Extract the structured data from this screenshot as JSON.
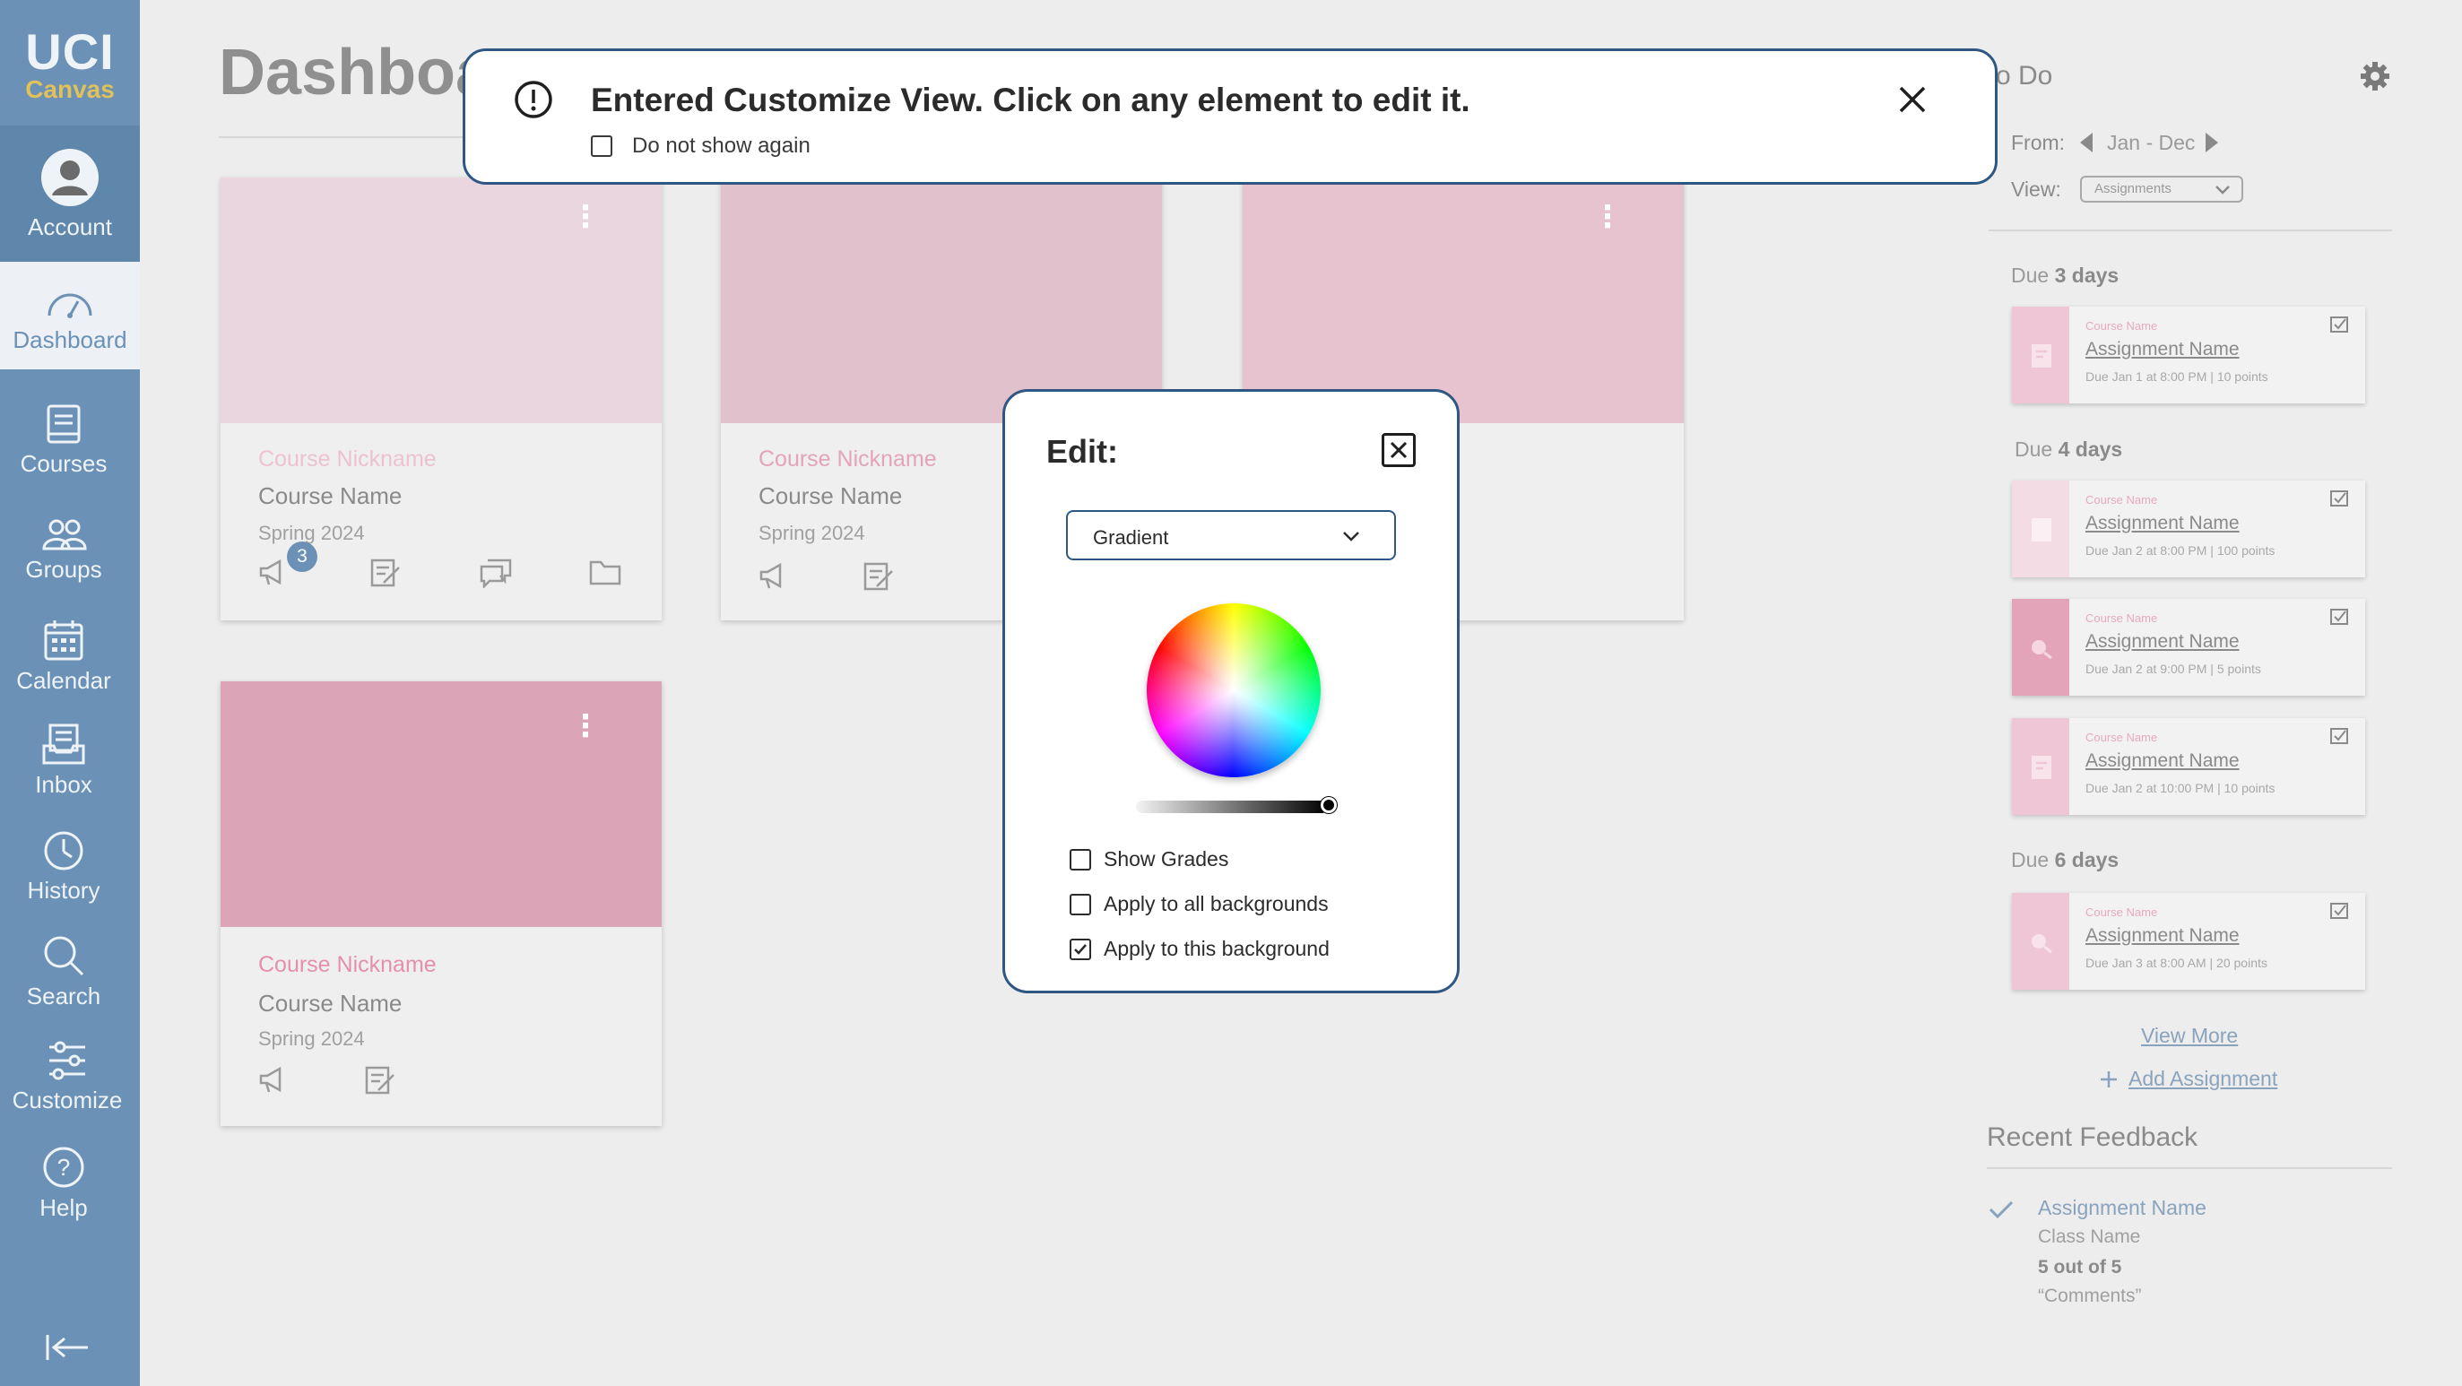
{
  "sidebar": {
    "logo_top": "UCI",
    "logo_bottom": "Canvas",
    "account": "Account",
    "dashboard": "Dashboard",
    "courses": "Courses",
    "groups": "Groups",
    "calendar": "Calendar",
    "inbox": "Inbox",
    "history": "History",
    "search": "Search",
    "customize": "Customize",
    "help": "Help"
  },
  "main": {
    "title": "Dashboa",
    "cards": [
      {
        "nickname": "Course Nickname",
        "name": "Course Name",
        "term": "Spring 2024",
        "badge": "3",
        "banner_color": "#ead6de",
        "nick_color": "#ecc2d1"
      },
      {
        "nickname": "Course Nickname",
        "name": "Course Name",
        "term": "Spring 2024",
        "banner_color": "#e0c1cc",
        "nick_color": "#e3a4ba"
      },
      {
        "nickname": "",
        "name": "",
        "term": "",
        "banner_color": "#e7c2cf"
      },
      {
        "nickname": "Course Nickname",
        "name": "Course Name",
        "term": "Spring 2024",
        "banner_color": "#dca5b7",
        "nick_color": "#e58fae"
      }
    ]
  },
  "todo": {
    "title": "o Do",
    "from_label": "From:",
    "range": "Jan - Dec",
    "view_label": "View:",
    "view_value": "Assignments",
    "groups": [
      {
        "label_pre": "Due",
        "label_bold": "3 days",
        "items": [
          {
            "course": "Course Name",
            "name": "Assignment Name",
            "due": "Due Jan 1 at 8:00 PM  |  10 points"
          }
        ]
      },
      {
        "label_pre": "Due",
        "label_bold": "4 days",
        "items": [
          {
            "course": "Course Name",
            "name": "Assignment Name",
            "due": "Due Jan 2 at 8:00 PM  |  100 points"
          },
          {
            "course": "Course Name",
            "name": "Assignment Name",
            "due": "Due Jan 2 at 9:00 PM  |  5 points"
          },
          {
            "course": "Course Name",
            "name": "Assignment Name",
            "due": "Due Jan 2 at 10:00 PM  |  10 points"
          }
        ]
      },
      {
        "label_pre": "Due",
        "label_bold": "6 days",
        "items": [
          {
            "course": "Course Name",
            "name": "Assignment Name",
            "due": "Due Jan 3 at 8:00 AM  |  20 points"
          }
        ]
      }
    ],
    "view_more": "View More",
    "add_assignment": "Add Assignment"
  },
  "feedback": {
    "title": "Recent Feedback",
    "assignment": "Assignment Name",
    "class": "Class Name",
    "score": "5 out of 5",
    "comments": "“Comments”"
  },
  "notice": {
    "message": "Entered Customize View. Click on any element to edit it.",
    "checkbox_label": "Do not show again"
  },
  "editor": {
    "title": "Edit:",
    "mode": "Gradient",
    "show_grades": "Show Grades",
    "apply_all": "Apply to all backgrounds",
    "apply_this": "Apply to this background",
    "apply_this_checked": true
  },
  "colors": {
    "sidebar": "#6b92b6",
    "accent_border": "#2f5784",
    "pink": "#e58fae"
  }
}
